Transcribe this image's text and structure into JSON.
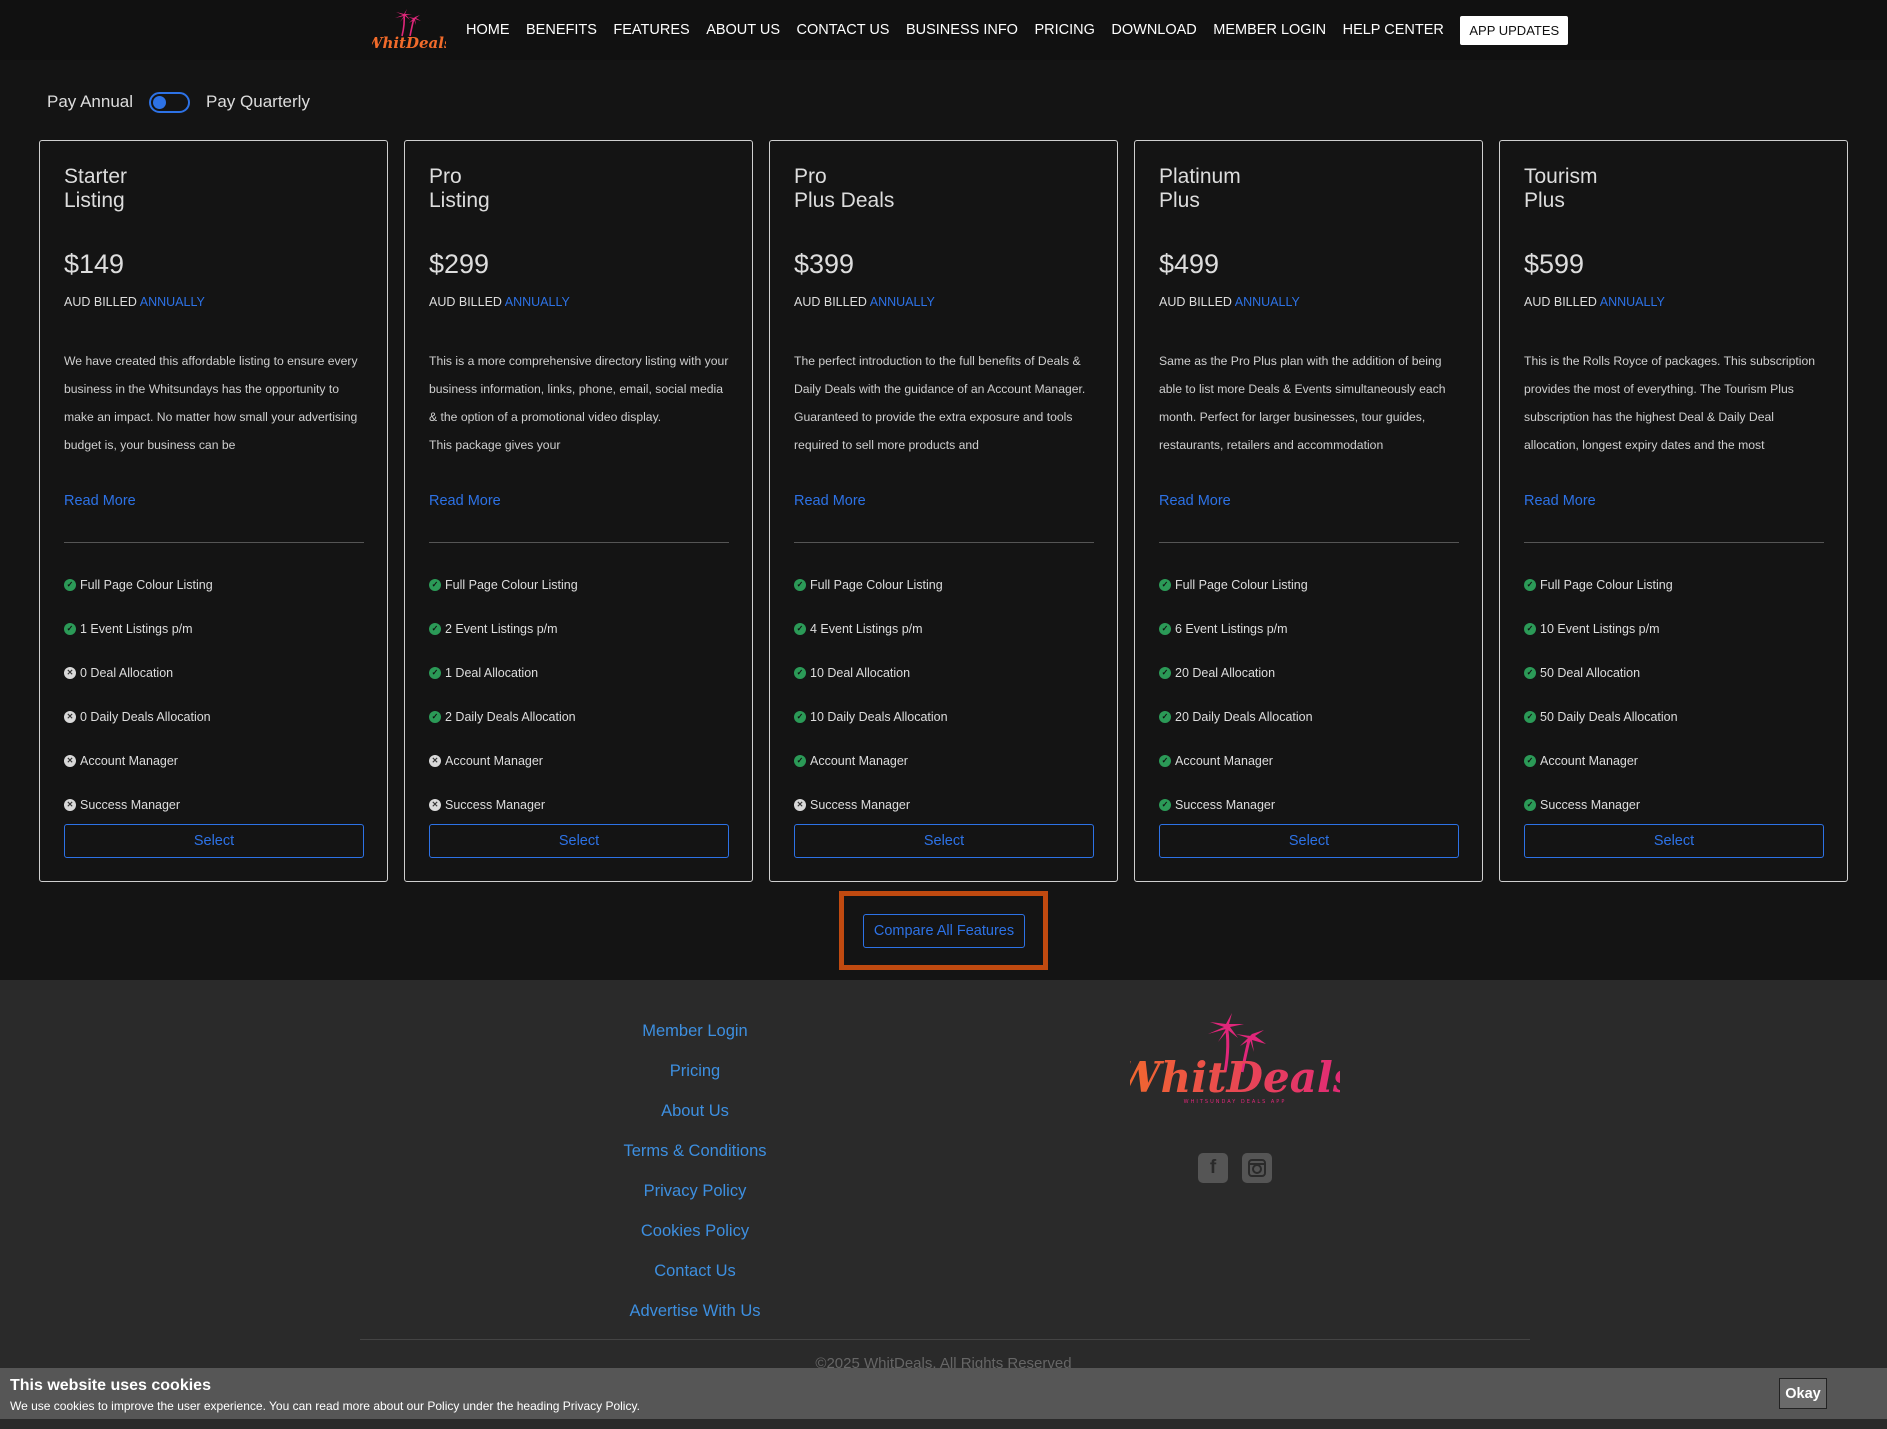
{
  "nav": {
    "logo_text": "WhitDeals",
    "links": [
      "HOME",
      "BENEFITS",
      "FEATURES",
      "ABOUT US",
      "CONTACT US",
      "BUSINESS INFO",
      "PRICING",
      "DOWNLOAD",
      "MEMBER LOGIN",
      "HELP CENTER"
    ],
    "cta": "APP UPDATES"
  },
  "billing": {
    "annual_label": "Pay Annual",
    "quarterly_label": "Pay Quarterly",
    "selected": "annual"
  },
  "plans": [
    {
      "title_line1": "Starter",
      "title_line2": "Listing",
      "price": "$149",
      "billed_prefix": "AUD BILLED",
      "billed_period": "ANNUALLY",
      "description": "We have created this affordable listing to ensure every business in the Whitsundays has the opportunity to make an impact. No matter how small your advertising budget is, your business can be",
      "read_more": "Read More",
      "features": [
        {
          "label": "Full Page Colour Listing",
          "included": true
        },
        {
          "label": "1 Event Listings p/m",
          "included": true
        },
        {
          "label": "0 Deal Allocation",
          "included": false
        },
        {
          "label": "0 Daily Deals Allocation",
          "included": false
        },
        {
          "label": "Account Manager",
          "included": false
        },
        {
          "label": "Success Manager",
          "included": false
        }
      ],
      "select_label": "Select"
    },
    {
      "title_line1": "Pro",
      "title_line2": "Listing",
      "price": "$299",
      "billed_prefix": "AUD BILLED",
      "billed_period": "ANNUALLY",
      "description": "This is a more comprehensive directory listing with your business information, links, phone, email, social media & the option of a promotional video display.\nThis package gives your",
      "read_more": "Read More",
      "features": [
        {
          "label": "Full Page Colour Listing",
          "included": true
        },
        {
          "label": "2 Event Listings p/m",
          "included": true
        },
        {
          "label": "1 Deal Allocation",
          "included": true
        },
        {
          "label": "2 Daily Deals Allocation",
          "included": true
        },
        {
          "label": "Account Manager",
          "included": false
        },
        {
          "label": "Success Manager",
          "included": false
        }
      ],
      "select_label": "Select"
    },
    {
      "title_line1": "Pro",
      "title_line2": "Plus Deals",
      "price": "$399",
      "billed_prefix": "AUD BILLED",
      "billed_period": "ANNUALLY",
      "description": "The perfect introduction to the full benefits of Deals & Daily Deals with the guidance of an Account Manager. Guaranteed to provide the extra exposure and tools required to sell more products and",
      "read_more": "Read More",
      "features": [
        {
          "label": "Full Page Colour Listing",
          "included": true
        },
        {
          "label": "4 Event Listings p/m",
          "included": true
        },
        {
          "label": "10 Deal Allocation",
          "included": true
        },
        {
          "label": "10 Daily Deals Allocation",
          "included": true
        },
        {
          "label": "Account Manager",
          "included": true
        },
        {
          "label": "Success Manager",
          "included": false
        }
      ],
      "select_label": "Select"
    },
    {
      "title_line1": "Platinum",
      "title_line2": "Plus",
      "price": "$499",
      "billed_prefix": "AUD BILLED",
      "billed_period": "ANNUALLY",
      "description": "Same as the Pro Plus plan with the addition of being able to list more Deals & Events simultaneously each month. Perfect for larger businesses, tour guides, restaurants, retailers and accommodation",
      "read_more": "Read More",
      "features": [
        {
          "label": "Full Page Colour Listing",
          "included": true
        },
        {
          "label": "6 Event Listings p/m",
          "included": true
        },
        {
          "label": "20 Deal Allocation",
          "included": true
        },
        {
          "label": "20 Daily Deals Allocation",
          "included": true
        },
        {
          "label": "Account Manager",
          "included": true
        },
        {
          "label": "Success Manager",
          "included": true
        }
      ],
      "select_label": "Select"
    },
    {
      "title_line1": "Tourism",
      "title_line2": "Plus",
      "price": "$599",
      "billed_prefix": "AUD BILLED",
      "billed_period": "ANNUALLY",
      "description": "This is the Rolls Royce of packages. This subscription provides the most of everything. The Tourism Plus subscription has the highest Deal & Daily Deal allocation, longest expiry dates and the most",
      "read_more": "Read More",
      "features": [
        {
          "label": "Full Page Colour Listing",
          "included": true
        },
        {
          "label": "10 Event Listings p/m",
          "included": true
        },
        {
          "label": "50 Deal Allocation",
          "included": true
        },
        {
          "label": "50 Daily Deals Allocation",
          "included": true
        },
        {
          "label": "Account Manager",
          "included": true
        },
        {
          "label": "Success Manager",
          "included": true
        }
      ],
      "select_label": "Select"
    }
  ],
  "compare_label": "Compare All Features",
  "footer": {
    "links": [
      "Member Login",
      "Pricing",
      "About Us",
      "Terms & Conditions",
      "Privacy Policy",
      "Cookies Policy",
      "Contact Us",
      "Advertise With Us"
    ],
    "logo_text": "WhitDeals",
    "logo_tagline": "WHITSUNDAY DEALS APP",
    "social_icons": [
      "facebook-icon",
      "instagram-icon"
    ],
    "copyright": "©2025 WhitDeals. All Rights Reserved"
  },
  "cookie": {
    "title": "This website uses cookies",
    "text": "We use cookies to improve the user experience. You can read more about our Policy under the heading Privacy Policy.",
    "ok": "Okay"
  },
  "colors": {
    "accent": "#2d72e6",
    "check": "#2b9a57",
    "highlight": "#c04a10",
    "logo_orange": "#f26b2a",
    "logo_pink": "#e0267a"
  }
}
